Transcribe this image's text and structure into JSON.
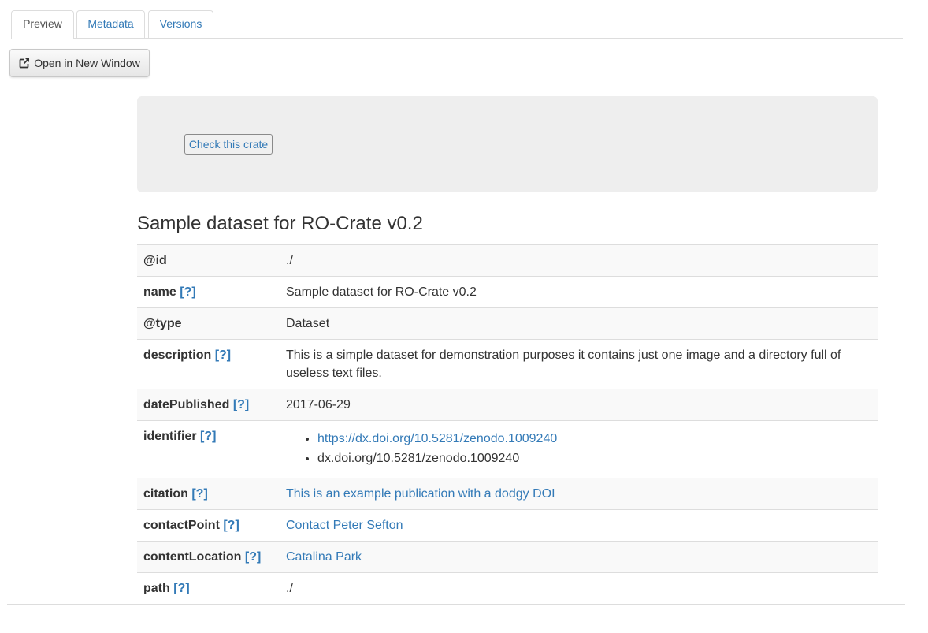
{
  "tabs": [
    {
      "label": "Preview",
      "active": true
    },
    {
      "label": "Metadata",
      "active": false
    },
    {
      "label": "Versions",
      "active": false
    }
  ],
  "toolbar": {
    "open_label": "Open in New Window",
    "open_icon": "external-link-icon"
  },
  "check": {
    "label": "Check this crate"
  },
  "dataset": {
    "title": "Sample dataset for RO-Crate v0.2",
    "help": "[?]",
    "rows": [
      {
        "key": "@id",
        "value": "./"
      },
      {
        "key": "name",
        "value": "Sample dataset for RO-Crate v0.2"
      },
      {
        "key": "@type",
        "value": "Dataset"
      },
      {
        "key": "description",
        "value": "This is a simple dataset for demonstration purposes it contains just one image and a directory full of useless text files."
      },
      {
        "key": "datePublished",
        "value": "2017-06-29"
      },
      {
        "key": "identifier",
        "items": [
          "https://dx.doi.org/10.5281/zenodo.1009240",
          "dx.doi.org/10.5281/zenodo.1009240"
        ]
      },
      {
        "key": "citation",
        "value": "This is an example publication with a dodgy DOI"
      },
      {
        "key": "contactPoint",
        "value": "Contact Peter Sefton"
      },
      {
        "key": "contentLocation",
        "value": "Catalina Park"
      },
      {
        "key": "path",
        "value": "./"
      }
    ]
  },
  "colors": {
    "link": "#337ab7",
    "well": "#eeeeee",
    "stripe": "#f9f9f9"
  }
}
